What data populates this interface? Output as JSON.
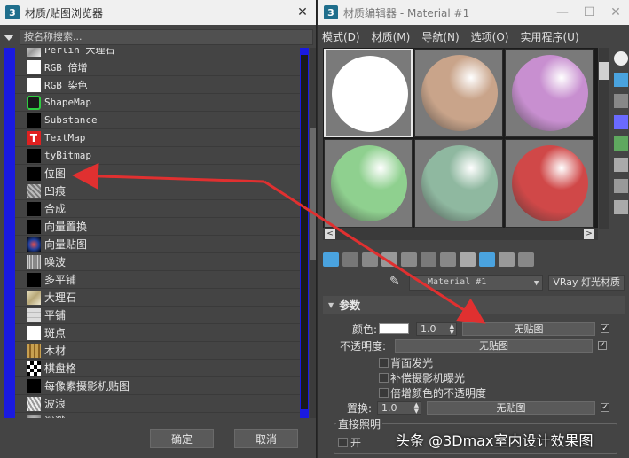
{
  "browser": {
    "title": "材质/贴图浏览器",
    "search_placeholder": "按名称搜索...",
    "items": [
      {
        "label": "Perlin 大理石",
        "swatch": "marble"
      },
      {
        "label": "RGB 倍增",
        "swatch": "white"
      },
      {
        "label": "RGB 染色",
        "swatch": "white"
      },
      {
        "label": "ShapeMap",
        "swatch": "shapemap"
      },
      {
        "label": "Substance",
        "swatch": "black"
      },
      {
        "label": "TextMap",
        "swatch": "textmap"
      },
      {
        "label": "tyBitmap",
        "swatch": "black"
      },
      {
        "label": "位图",
        "swatch": "black"
      },
      {
        "label": "凹痕",
        "swatch": "dent"
      },
      {
        "label": "合成",
        "swatch": "black"
      },
      {
        "label": "向量置换",
        "swatch": "black"
      },
      {
        "label": "向量贴图",
        "swatch": "vector"
      },
      {
        "label": "噪波",
        "swatch": "noise"
      },
      {
        "label": "多平铺",
        "swatch": "black"
      },
      {
        "label": "大理石",
        "swatch": "marble2"
      },
      {
        "label": "平铺",
        "swatch": "tile"
      },
      {
        "label": "斑点",
        "swatch": "white"
      },
      {
        "label": "木材",
        "swatch": "wood"
      },
      {
        "label": "棋盘格",
        "swatch": "checker"
      },
      {
        "label": "每像素摄影机贴图",
        "swatch": "black"
      },
      {
        "label": "波浪",
        "swatch": "wave"
      },
      {
        "label": "泼溅",
        "swatch": "splat"
      }
    ],
    "ok_label": "确定",
    "cancel_label": "取消"
  },
  "editor": {
    "title": "材质编辑器 - Material #1",
    "menu": [
      "模式(D)",
      "材质(M)",
      "导航(N)",
      "选项(O)",
      "实用程序(U)"
    ],
    "spheres": [
      "#ffffff",
      "#c9a48a",
      "#c88fd0",
      "#8fd08f",
      "#8fb8a0",
      "#d04848"
    ],
    "material_name": "Material #1",
    "material_type": "VRay 灯光材质",
    "section_title": "参数",
    "color_label": "颜色:",
    "color_value": "1.0",
    "color_map": "无贴图",
    "opacity_label": "不透明度:",
    "opacity_map": "无贴图",
    "checkbox_backside": "背面发光",
    "checkbox_compensate": "补偿摄影机曝光",
    "checkbox_multiply": "倍增颜色的不透明度",
    "displace_label": "置换:",
    "displace_value": "1.0",
    "displace_map": "无贴图",
    "direct_light_group": "直接照明",
    "direct_light_on": "开"
  },
  "watermark": "头条 @3Dmax室内设计效果图",
  "annotation_color": "#e03030"
}
